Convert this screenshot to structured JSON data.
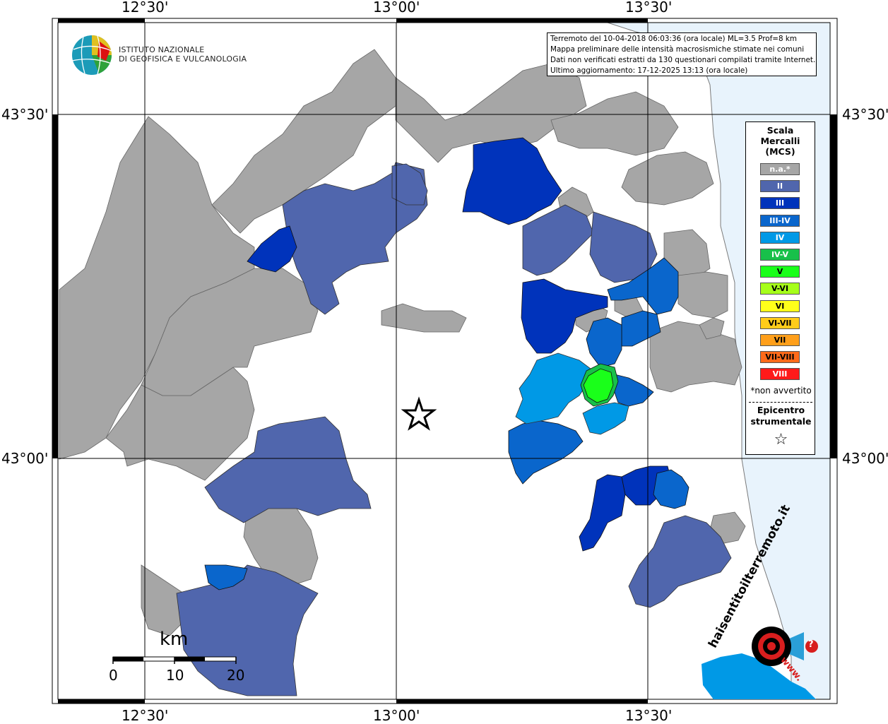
{
  "map": {
    "lon_labels": [
      "12°30'",
      "13°00'",
      "13°30'"
    ],
    "lat_labels": [
      "43°30'",
      "43°00'"
    ]
  },
  "header": {
    "org_line1": "ISTITUTO NAZIONALE",
    "org_line2": "DI GEOFISICA E VULCANOLOGIA"
  },
  "info": {
    "line1": "Terremoto del 10-04-2018 06:03:36 (ora locale) ML=3.5 Prof=8 km",
    "line2": "Mappa preliminare delle intensità macrosismiche stimate nei comuni",
    "line3": "Dati non verificati estratti da 130 questionari compilati tramite Internet.",
    "line4": "Ultimo aggiornamento: 17-12-2025 13:13 (ora locale)"
  },
  "legend": {
    "title_line1": "Scala",
    "title_line2": "Mercalli",
    "title_line3": "(MCS)",
    "items": [
      {
        "label": "n.a.*",
        "color": "#a6a6a6",
        "text": "#ffffff"
      },
      {
        "label": "II",
        "color": "#5066ad",
        "text": "#ffffff"
      },
      {
        "label": "III",
        "color": "#0033bb",
        "text": "#ffffff"
      },
      {
        "label": "III-IV",
        "color": "#0a66cc",
        "text": "#ffffff"
      },
      {
        "label": "IV",
        "color": "#0099e6",
        "text": "#ffffff"
      },
      {
        "label": "IV-V",
        "color": "#18c04a",
        "text": "#ffffff"
      },
      {
        "label": "V",
        "color": "#1aff1a",
        "text": "#000000"
      },
      {
        "label": "V-VI",
        "color": "#a6ff1a",
        "text": "#000000"
      },
      {
        "label": "VI",
        "color": "#ffff1a",
        "text": "#000000"
      },
      {
        "label": "VI-VII",
        "color": "#ffcc1a",
        "text": "#000000"
      },
      {
        "label": "VII",
        "color": "#ff9f1a",
        "text": "#000000"
      },
      {
        "label": "VII-VIII",
        "color": "#ff6a1a",
        "text": "#000000"
      },
      {
        "label": "VIII",
        "color": "#ff1a1a",
        "text": "#ffffff"
      }
    ],
    "note": "*non avvertito",
    "epicenter_line1": "Epicentro",
    "epicenter_line2": "strumentale",
    "epicenter_symbol": "☆"
  },
  "scalebar": {
    "unit": "km",
    "ticks": [
      "0",
      "10",
      "20"
    ]
  },
  "brand": {
    "text": "haisentitoilterremoto.it",
    "prefix": "www.",
    "question_mark": "?"
  },
  "colors": {
    "sea": "#e8f3fc",
    "na": "#a6a6a6",
    "II": "#5066ad",
    "III": "#0033bb",
    "III_IV": "#0a66cc",
    "IV": "#0099e6",
    "IV_V": "#18c04a",
    "V": "#1aff1a"
  }
}
